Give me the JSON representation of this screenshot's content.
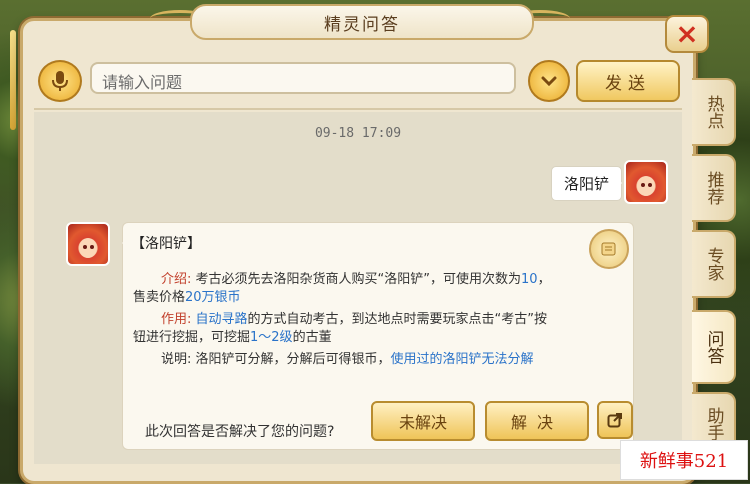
{
  "window": {
    "title": "精灵问答",
    "close_label": "×"
  },
  "topbar": {
    "search_placeholder": "请输入问题",
    "send_label": "发送"
  },
  "chat": {
    "timestamp": "09-18  17:09",
    "user_message": "洛阳铲",
    "answer": {
      "title": "【洛阳铲】",
      "intro_label": "介绍:",
      "intro_text_a": "考古必须先去洛阳杂货商人购买“洛阳铲”，可使用次数为",
      "intro_count": "10",
      "intro_text_b": "，",
      "intro_line2_a": "售卖价格",
      "intro_price": "20万银币",
      "use_label": "作用:",
      "use_link": "自动寻路",
      "use_text": "的方式自动考古，到达地点时需要玩家点击“考古”按",
      "use_line2_a": "钮进行挖掘，可挖掘",
      "use_levels": "1～2级",
      "use_line2_b": "的古董",
      "note_label": "说明:",
      "note_text": "洛阳铲可分解，分解后可得银币，",
      "note_blue": "使用过的洛阳铲无法分解"
    },
    "feedback_question": "此次回答是否解决了您的问题?",
    "unresolved_label": "未解决",
    "resolved_label": "解决"
  },
  "side_tabs": [
    "热点",
    "推荐",
    "专家",
    "问答",
    "助手"
  ],
  "active_tab": "问答",
  "watermark": "新鲜事521",
  "colors": {
    "accent": "#f0c860",
    "label_red": "#c2402c",
    "link_blue": "#2a73c9",
    "panel_bg": "#efe6d0"
  }
}
